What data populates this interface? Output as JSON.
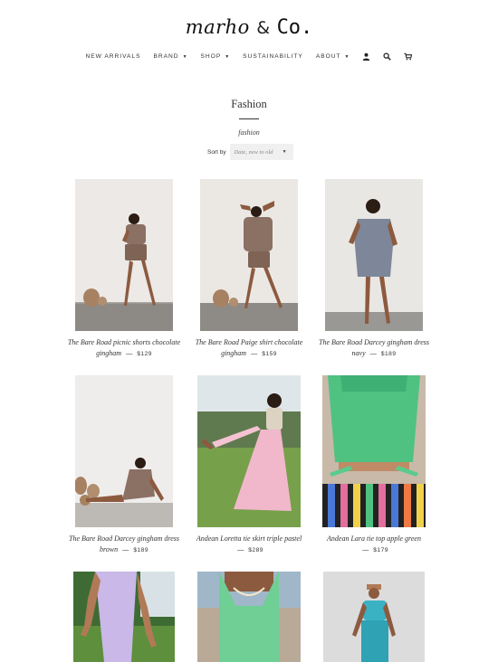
{
  "brand": {
    "script": "marho",
    "amp": "&",
    "co": "Co."
  },
  "nav": [
    {
      "label": "NEW ARRIVALS",
      "caret": false
    },
    {
      "label": "BRAND",
      "caret": true
    },
    {
      "label": "SHOP",
      "caret": true
    },
    {
      "label": "SUSTAINABILITY",
      "caret": false
    },
    {
      "label": "ABOUT",
      "caret": true
    }
  ],
  "nav_icons": [
    "user-icon",
    "search-icon",
    "cart-icon"
  ],
  "collection": {
    "title": "Fashion",
    "subtitle": "fashion"
  },
  "sort": {
    "label": "Sort by",
    "value": "Date, new to old"
  },
  "products": [
    {
      "name_line1": "The Bare Road picnic shorts chocolate",
      "name_line2": "gingham",
      "price": "$129"
    },
    {
      "name_line1": "The Bare Road Paige shirt chocolate",
      "name_line2": "gingham",
      "price": "$159"
    },
    {
      "name_line1": "The Bare Road Darcey gingham dress",
      "name_line2": "navy",
      "price": "$189"
    },
    {
      "name_line1": "The Bare Road Darcey gingham dress",
      "name_line2": "brown",
      "price": "$189"
    },
    {
      "name_line1": "Andean Loretta tie skirt triple pastel",
      "name_line2": "",
      "price": "$289"
    },
    {
      "name_line1": "Andean Lara tie top apple green",
      "name_line2": "",
      "price": "$179"
    }
  ],
  "dash": "—"
}
